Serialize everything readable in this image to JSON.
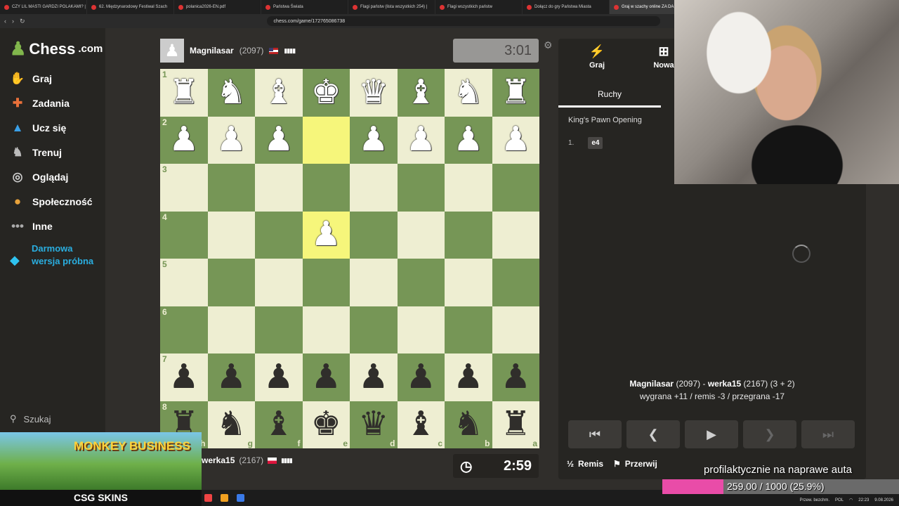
{
  "browser": {
    "tabs": [
      {
        "label": "CZY LIL MASTI GARDZI POLAKAMI? |",
        "active": false
      },
      {
        "label": "62. Międzynarodowy Festiwal Szach",
        "active": false
      },
      {
        "label": "polanica2026-EN.pdf",
        "active": false
      },
      {
        "label": "Państwa Świata",
        "active": false
      },
      {
        "label": "Flagi państw (lista wszystkich 254) |",
        "active": false
      },
      {
        "label": "Flagi wszystkich państw",
        "active": false
      },
      {
        "label": "Dołącz do gry Państwa Miasta",
        "active": false
      },
      {
        "label": "Graj w szachy online ZA DA",
        "active": true
      }
    ],
    "url": "chess.com/game/172765086738"
  },
  "sidebar": {
    "logo_text": "Chess",
    "logo_suffix": ".com",
    "items": [
      {
        "label": "Graj",
        "icon": "play-hand-icon"
      },
      {
        "label": "Zadania",
        "icon": "puzzle-icon"
      },
      {
        "label": "Ucz się",
        "icon": "graduation-cap-icon"
      },
      {
        "label": "Trenuj",
        "icon": "training-icon"
      },
      {
        "label": "Oglądaj",
        "icon": "binoculars-icon"
      },
      {
        "label": "Społeczność",
        "icon": "community-icon"
      },
      {
        "label": "Inne",
        "icon": "more-dots-icon"
      }
    ],
    "trial_label": "Darmowa wersja próbna",
    "search_label": "Szukaj"
  },
  "top_player": {
    "name": "Magnilasar",
    "rating": "(2097)",
    "clock": "3:01"
  },
  "bottom_player": {
    "name": "werka15",
    "rating": "(2167)",
    "clock": "2:59"
  },
  "board": {
    "ranks": [
      "1",
      "2",
      "3",
      "4",
      "5",
      "6",
      "7",
      "8"
    ],
    "files": [
      "h",
      "g",
      "f",
      "e",
      "d",
      "c",
      "b",
      "a"
    ],
    "rows": [
      [
        "♜",
        "♞",
        "♝",
        "♚",
        "♛",
        "♝",
        "♞",
        "♜"
      ],
      [
        "♟",
        "♟",
        "♟",
        "",
        "♟",
        "♟",
        "♟",
        "♟"
      ],
      [
        "",
        "",
        "",
        "",
        "",
        "",
        "",
        ""
      ],
      [
        "",
        "",
        "",
        "♟",
        "",
        "",
        "",
        ""
      ],
      [
        "",
        "",
        "",
        "",
        "",
        "",
        "",
        ""
      ],
      [
        "",
        "",
        "",
        "",
        "",
        "",
        "",
        ""
      ],
      [
        "♟",
        "♟",
        "♟",
        "♟",
        "♟",
        "♟",
        "♟",
        "♟"
      ],
      [
        "♜",
        "♞",
        "♝",
        "♚",
        "♛",
        "♝",
        "♞",
        "♜"
      ]
    ],
    "colors": [
      [
        "w",
        "w",
        "w",
        "w",
        "w",
        "w",
        "w",
        "w"
      ],
      [
        "w",
        "w",
        "w",
        "",
        "w",
        "w",
        "w",
        "w"
      ],
      [
        "",
        "",
        "",
        "",
        "",
        "",
        "",
        ""
      ],
      [
        "",
        "",
        "",
        "w",
        "",
        "",
        "",
        ""
      ],
      [
        "",
        "",
        "",
        "",
        "",
        "",
        "",
        ""
      ],
      [
        "",
        "",
        "",
        "",
        "",
        "",
        "",
        ""
      ],
      [
        "b",
        "b",
        "b",
        "b",
        "b",
        "b",
        "b",
        "b"
      ],
      [
        "b",
        "b",
        "b",
        "b",
        "b",
        "b",
        "b",
        "b"
      ]
    ],
    "highlight": [
      [
        1,
        3
      ],
      [
        3,
        3
      ]
    ]
  },
  "panel": {
    "tab_play": "Graj",
    "tab_new": "Nowa",
    "subtab_moves": "Ruchy",
    "opening": "King's Pawn Opening",
    "move_number": "1.",
    "move_white": "e4",
    "summary_white": "Magnilasar",
    "summary_white_rating": "(2097)",
    "summary_sep": " - ",
    "summary_black": "werka15",
    "summary_black_rating": "(2167)",
    "summary_time": "(3 + 2)",
    "summary_stats": "wygrana +11 / remis -3 / przegrana -17",
    "draw_label": "Remis",
    "draw_symbol": "½",
    "resign_label": "Przerwij"
  },
  "overlays": {
    "ad_title": "MONKEY BUSINESS",
    "ad_brand": "CSG SKINS",
    "caption": "profilaktycznie na naprawe auta",
    "goal_text": "259.00 / 1000 (25.9%)",
    "goal_progress": 0.259
  },
  "tray": {
    "lang": "POL",
    "time": "22:23",
    "date": "9.08.2026",
    "weather": "Przew. bezchm."
  },
  "colors": {
    "light_square": "#eeeed2",
    "dark_square": "#769656",
    "highlight": "#f6f67b",
    "accent_green": "#81b64c",
    "trial_blue": "#2aaee0",
    "goal_pink": "#e94ca8"
  }
}
